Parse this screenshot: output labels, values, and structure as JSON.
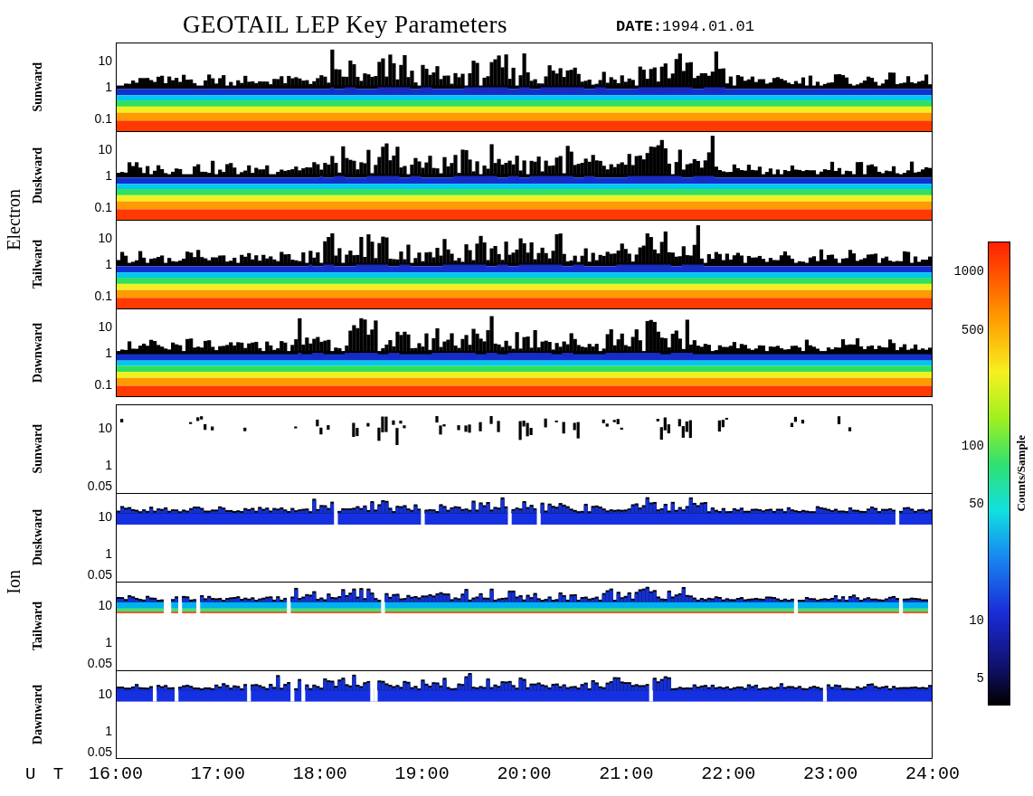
{
  "title": "GEOTAIL LEP Key Parameters",
  "date": {
    "label": "DATE:",
    "value": "1994.01.01"
  },
  "groups": [
    {
      "name": "Electron",
      "kind": "electron",
      "panels": [
        {
          "label": "Sunward",
          "yticks": [
            "10",
            "1",
            "0.1"
          ]
        },
        {
          "label": "Duskward",
          "yticks": [
            "10",
            "1",
            "0.1"
          ]
        },
        {
          "label": "Tailward",
          "yticks": [
            "10",
            "1",
            "0.1"
          ]
        },
        {
          "label": "Dawnward",
          "yticks": [
            "10",
            "1",
            "0.1"
          ]
        }
      ]
    },
    {
      "name": "Ion",
      "kind": "ion",
      "panels": [
        {
          "label": "Sunward",
          "yticks": [
            "10",
            "1",
            "0.05"
          ]
        },
        {
          "label": "Duskward",
          "yticks": [
            "10",
            "1",
            "0.05"
          ]
        },
        {
          "label": "Tailward",
          "yticks": [
            "10",
            "1",
            "0.05"
          ]
        },
        {
          "label": "Dawnward",
          "yticks": [
            "10",
            "1",
            "0.05"
          ]
        }
      ]
    }
  ],
  "x_axis": {
    "label": "U T",
    "ticks": [
      "16:00",
      "17:00",
      "18:00",
      "19:00",
      "20:00",
      "21:00",
      "22:00",
      "23:00",
      "24:00"
    ]
  },
  "colorbar": {
    "title": "Counts/Sample",
    "ticks": [
      "1000",
      "500",
      "100",
      "50",
      "10",
      "5"
    ]
  }
}
